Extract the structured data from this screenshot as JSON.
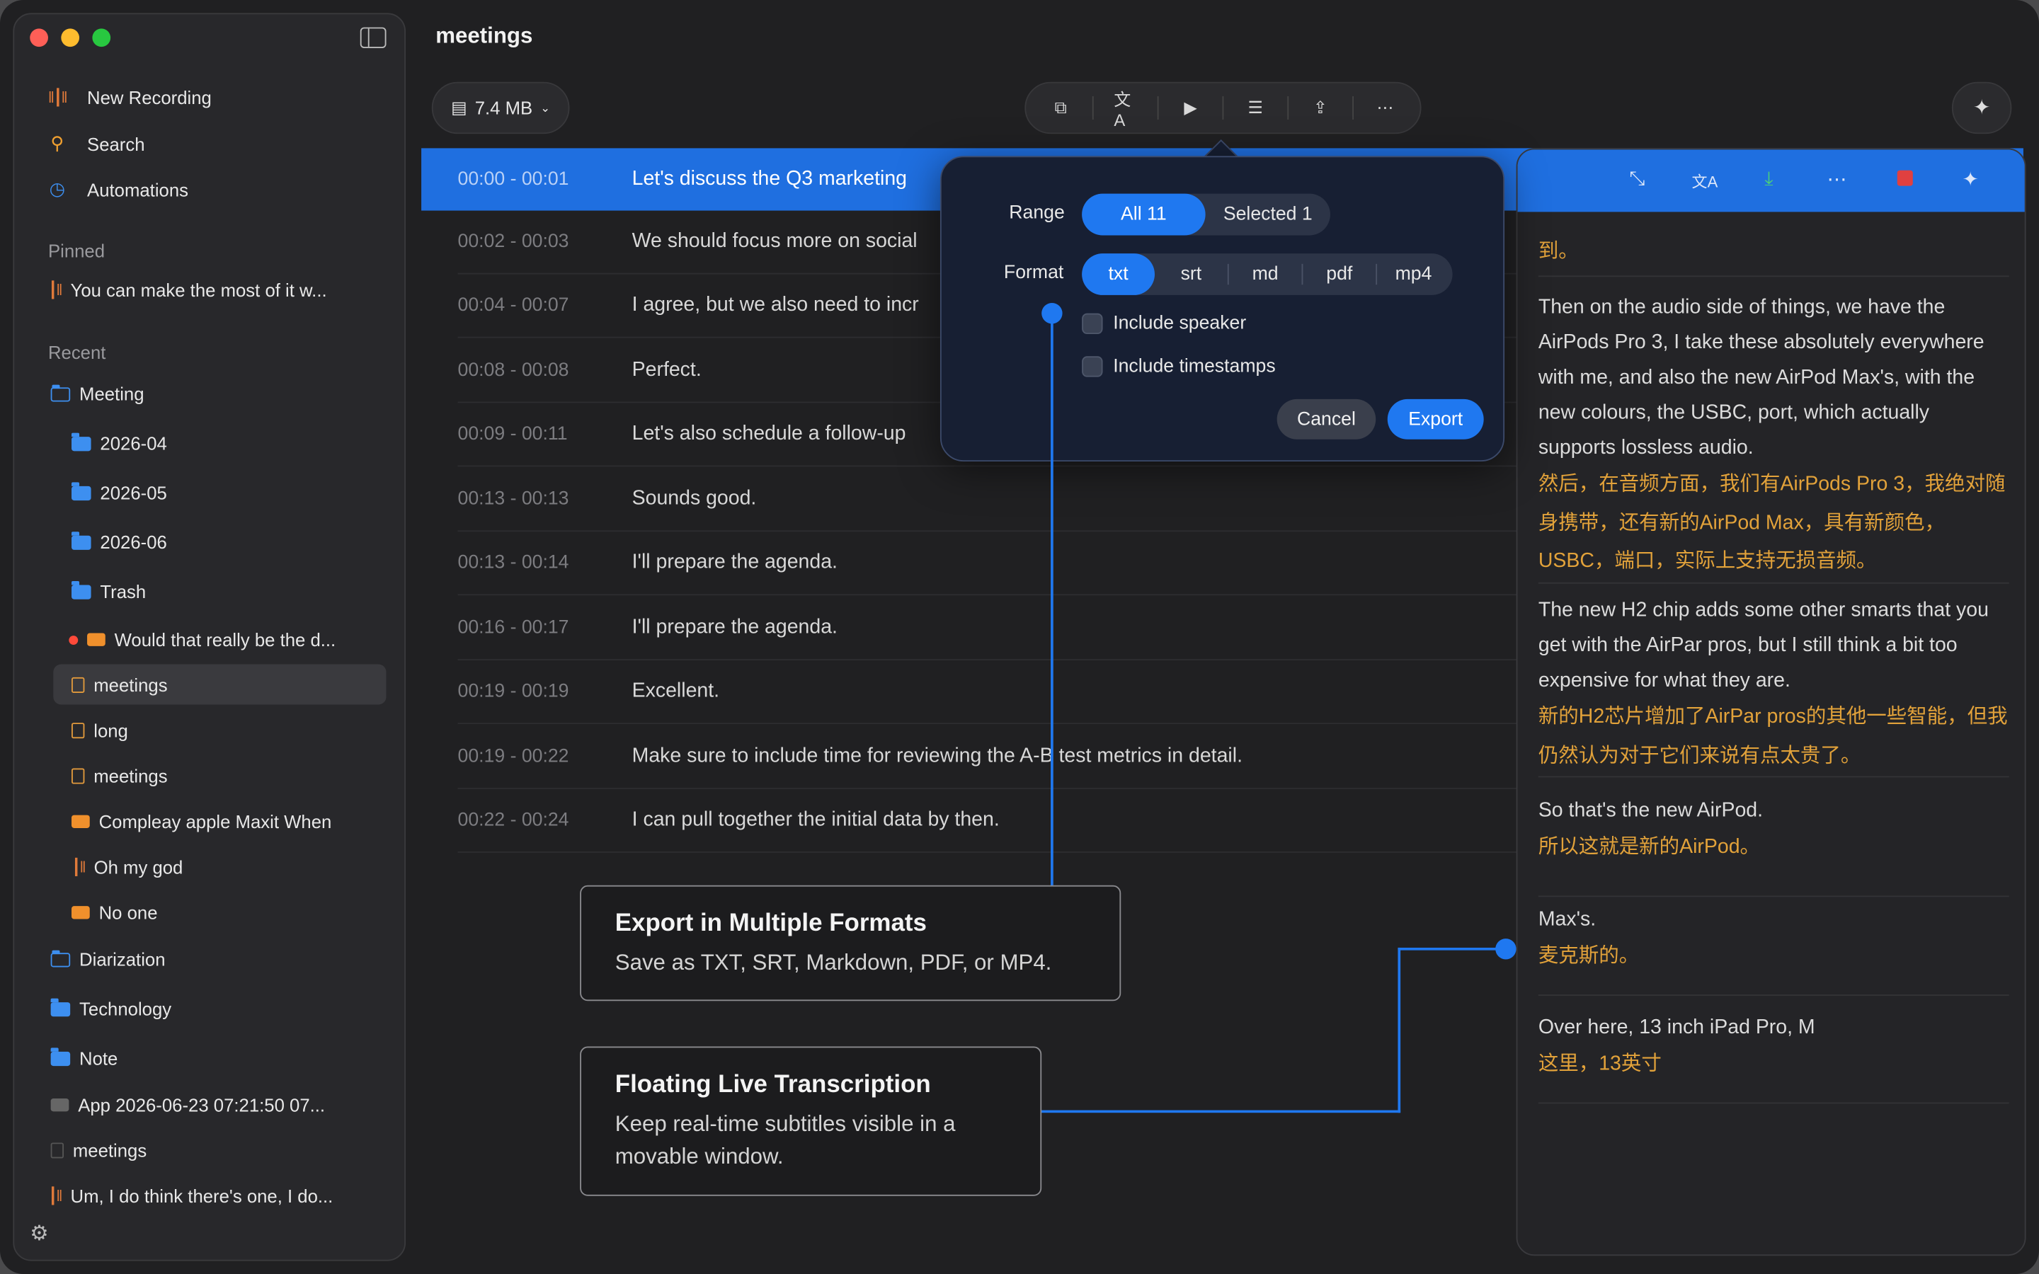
{
  "sidebar": {
    "nav": [
      {
        "label": "New Recording",
        "icon": "waveform-icon"
      },
      {
        "label": "Search",
        "icon": "search-icon"
      },
      {
        "label": "Automations",
        "icon": "clock-icon"
      }
    ],
    "pinned_label": "Pinned",
    "pinned_item": "You can make the most of it w...",
    "recent_label": "Recent",
    "tree": [
      "Meeting",
      "2026-04",
      "2026-05",
      "2026-06",
      "Trash",
      "Would that really be the d...",
      "meetings",
      "long",
      "meetings",
      "Compleay apple Maxit When",
      "Oh my god",
      "No one",
      "Diarization",
      "Technology",
      "Note",
      "App 2026-06-23 07:21:50 07...",
      "meetings",
      "Um, I do think there's one, I do..."
    ]
  },
  "header": {
    "title": "meetings",
    "file_size": "7.4 MB"
  },
  "transcript": [
    {
      "ts": "00:00 - 00:01",
      "text": "Let's discuss the Q3 marketing"
    },
    {
      "ts": "00:02 - 00:03",
      "text": "We should focus more on social"
    },
    {
      "ts": "00:04 - 00:07",
      "text": "I agree, but we also need to incr"
    },
    {
      "ts": "00:08 - 00:08",
      "text": "Perfect."
    },
    {
      "ts": "00:09 - 00:11",
      "text": "Let's also schedule a follow-up"
    },
    {
      "ts": "00:13 - 00:13",
      "text": "Sounds good."
    },
    {
      "ts": "00:13 - 00:14",
      "text": "I'll prepare the agenda."
    },
    {
      "ts": "00:16 - 00:17",
      "text": "I'll prepare the agenda."
    },
    {
      "ts": "00:19 - 00:19",
      "text": "Excellent."
    },
    {
      "ts": "00:19 - 00:22",
      "text": "Make sure to include time for reviewing the A-B test metrics in detail."
    },
    {
      "ts": "00:22 - 00:24",
      "text": "I can pull together the initial data by then."
    }
  ],
  "export_popover": {
    "range_label": "Range",
    "range_options": [
      "All 11",
      "Selected 1"
    ],
    "format_label": "Format",
    "format_options": [
      "txt",
      "srt",
      "md",
      "pdf",
      "mp4"
    ],
    "include_speaker": "Include speaker",
    "include_timestamps": "Include timestamps",
    "cancel": "Cancel",
    "export": "Export"
  },
  "live_panel": {
    "blocks": [
      {
        "en": "",
        "zh": "到。"
      },
      {
        "en": "Then on the audio side of things, we have the AirPods Pro 3, I take these absolutely everywhere with me, and also the new AirPod Max's, with the new colours, the USBC, port, which actually supports lossless audio.",
        "zh": "然后，在音频方面，我们有AirPods Pro 3，我绝对随身携带，还有新的AirPod Max，具有新颜色，USBC，端口，实际上支持无损音频。"
      },
      {
        "en": "The new H2 chip adds some other smarts that you get with the AirPar pros, but I still think a bit too expensive for what they are.",
        "zh": "新的H2芯片增加了AirPar pros的其他一些智能，但我仍然认为对于它们来说有点太贵了。"
      },
      {
        "en": "So that's the new AirPod.",
        "zh": "所以这就是新的AirPod。"
      },
      {
        "en": "Max's.",
        "zh": "麦克斯的。"
      },
      {
        "en": "Over here, 13 inch iPad Pro, M",
        "zh": "这里，13英寸"
      }
    ]
  },
  "callouts": [
    {
      "title": "Export in Multiple Formats",
      "text": "Save as TXT, SRT, Markdown, PDF, or MP4."
    },
    {
      "title": "Floating Live Transcription",
      "text": "Keep real-time subtitles visible in a movable window."
    }
  ],
  "colors": {
    "accent": "#1f78f0",
    "translation": "#e2a23a",
    "recording_red": "#e04040"
  }
}
